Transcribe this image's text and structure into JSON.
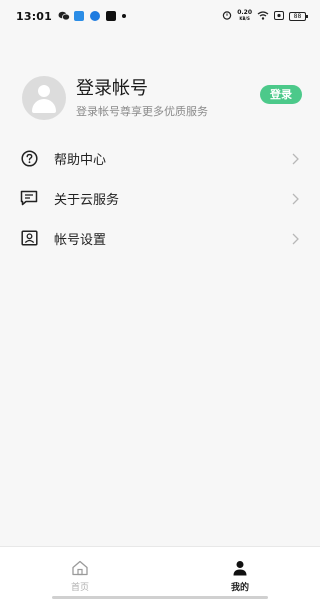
{
  "status_bar": {
    "time": "13:01",
    "net_speed_value": "0.20",
    "net_speed_unit": "KB/S",
    "battery_level": "88",
    "app_icons": [
      "wechat-icon",
      "mail-app-icon",
      "tv-app-icon",
      "tiktok-icon"
    ]
  },
  "profile": {
    "name": "登录帐号",
    "subtitle": "登录帐号尊享更多优质服务",
    "login_button": "登录",
    "accent_color": "#4cc98a"
  },
  "menu": {
    "items": [
      {
        "label": "帮助中心",
        "icon": "help-icon"
      },
      {
        "label": "关于云服务",
        "icon": "message-icon"
      },
      {
        "label": "帐号设置",
        "icon": "account-settings-icon"
      }
    ]
  },
  "tab_bar": {
    "tabs": [
      {
        "label": "首页",
        "icon": "home-icon",
        "active": false
      },
      {
        "label": "我的",
        "icon": "person-icon",
        "active": true
      }
    ]
  }
}
